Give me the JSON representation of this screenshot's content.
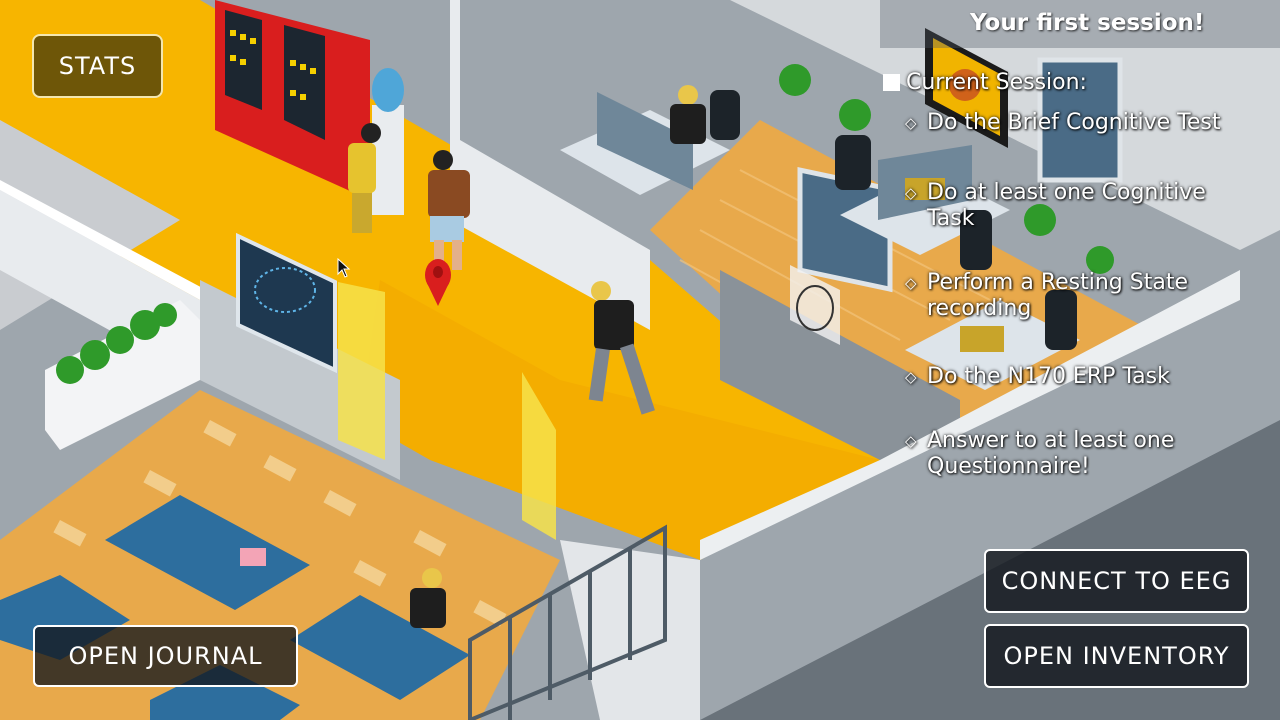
{
  "hud": {
    "stats_label": "STATS",
    "journal_label": "OPEN JOURNAL",
    "eeg_label": "CONNECT TO EEG",
    "inventory_label": "OPEN INVENTORY"
  },
  "session": {
    "title": "Your first session!",
    "current_label": "Current Session:",
    "tasks": [
      {
        "label": "Do the Brief Cognitive Test",
        "icon": "diamond-icon"
      },
      {
        "label": "Do at least one Cognitive Task",
        "icon": "diamond-icon"
      },
      {
        "label": "Perform a Resting State recording",
        "icon": "diamond-icon"
      },
      {
        "label": "Do the N170 ERP Task",
        "icon": "diamond-icon"
      },
      {
        "label": "Answer to at least one Questionnaire!",
        "icon": "diamond-icon"
      }
    ]
  },
  "colors": {
    "corridor": "#f7b500",
    "floor_wood": "#e9a94a",
    "wall": "#e8ebee",
    "wall_shadow": "#9aa1a8",
    "vending": "#d91e1e",
    "table": "#2d6e9e",
    "button_dark": "#14181e",
    "stats_brown": "#6e5608"
  }
}
